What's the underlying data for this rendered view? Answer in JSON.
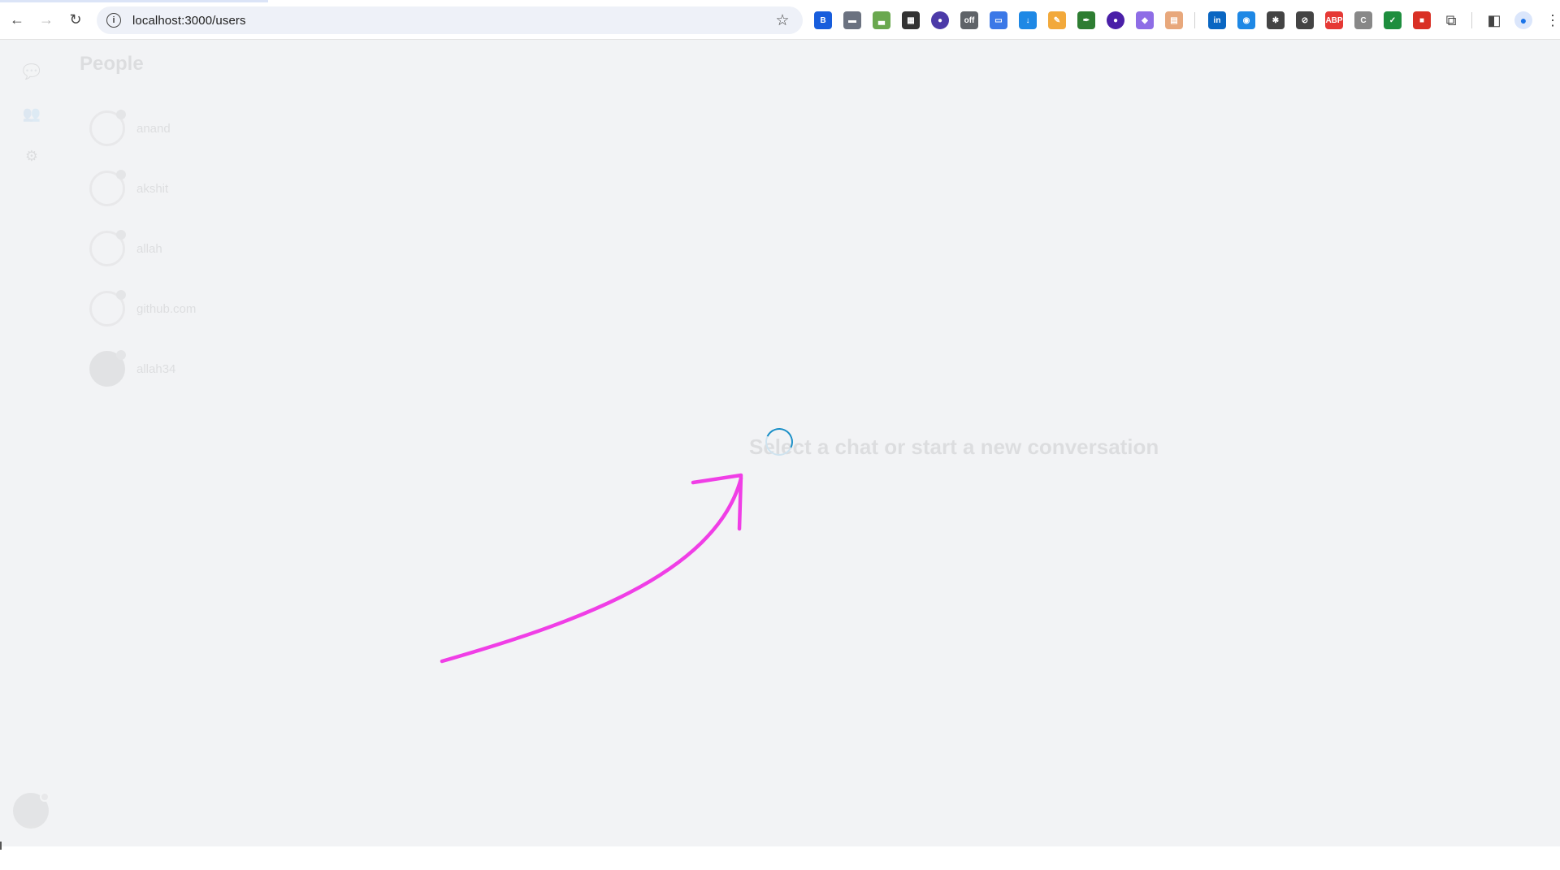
{
  "browser": {
    "url": "localhost:3000/users",
    "site_info_glyph": "i",
    "bookmark_glyph": "☆",
    "nav": {
      "back": "←",
      "forward": "→",
      "reload": "↻"
    },
    "extensions": [
      {
        "name": "bitwarden-icon",
        "color": "#175ddc",
        "glyph": "B"
      },
      {
        "name": "video-tool-icon",
        "color": "#6b7280",
        "glyph": "▬"
      },
      {
        "name": "grass-tool-icon",
        "color": "#6aa84f",
        "glyph": "▃"
      },
      {
        "name": "qr-code-icon",
        "color": "#333333",
        "glyph": "▦"
      },
      {
        "name": "shopping-bag-icon",
        "color": "#4c3aa8",
        "glyph": "●"
      },
      {
        "name": "incognito-off-icon",
        "color": "#5f6368",
        "glyph": "off"
      },
      {
        "name": "screen-capture-icon",
        "color": "#3b78e7",
        "glyph": "▭"
      },
      {
        "name": "download-icon",
        "color": "#1e88e5",
        "glyph": "↓"
      },
      {
        "name": "highlighter-icon",
        "color": "#f2a93b",
        "glyph": "✎"
      },
      {
        "name": "pen-tool-icon",
        "color": "#2e7d32",
        "glyph": "✒"
      },
      {
        "name": "proton-icon",
        "color": "#4a1fa8",
        "glyph": "●"
      },
      {
        "name": "paint-icon",
        "color": "#8e6de6",
        "glyph": "◆"
      },
      {
        "name": "calendar-icon",
        "color": "#e8a87c",
        "glyph": "▤"
      },
      {
        "name": "linkedin-icon",
        "color": "#0a66c2",
        "glyph": "in"
      },
      {
        "name": "camera-icon",
        "color": "#1e88e5",
        "glyph": "◉"
      },
      {
        "name": "bug-icon",
        "color": "#444444",
        "glyph": "✱"
      },
      {
        "name": "timer-off-icon",
        "color": "#444444",
        "glyph": "⊘"
      },
      {
        "name": "adblock-icon",
        "color": "#e53935",
        "glyph": "ABP"
      },
      {
        "name": "code-icon",
        "color": "#888888",
        "glyph": "C"
      },
      {
        "name": "shield-icon",
        "color": "#1e8e3e",
        "glyph": "✓"
      },
      {
        "name": "video-record-icon",
        "color": "#d93025",
        "glyph": "■"
      }
    ],
    "puzzle_glyph": "⧉",
    "side_panel_glyph": "◧",
    "profile_glyph": "●",
    "menu_glyph": "⋮"
  },
  "app": {
    "rail_icons": [
      {
        "name": "chat-icon",
        "glyph": "💬"
      },
      {
        "name": "people-icon",
        "glyph": "👥"
      },
      {
        "name": "settings-icon",
        "glyph": "⚙"
      }
    ],
    "people_title": "People",
    "users": [
      {
        "name": "anand",
        "avatar": "outline"
      },
      {
        "name": "akshit",
        "avatar": "outline"
      },
      {
        "name": "allah",
        "avatar": "outline"
      },
      {
        "name": "github.com",
        "avatar": "outline"
      },
      {
        "name": "allah34",
        "avatar": "filled"
      }
    ],
    "empty_message": "Select a chat or start a new conversation"
  },
  "colors": {
    "page_bg": "#f2f3f5",
    "spinner": "#1a8fc7",
    "annotation": "#f03ee6"
  }
}
